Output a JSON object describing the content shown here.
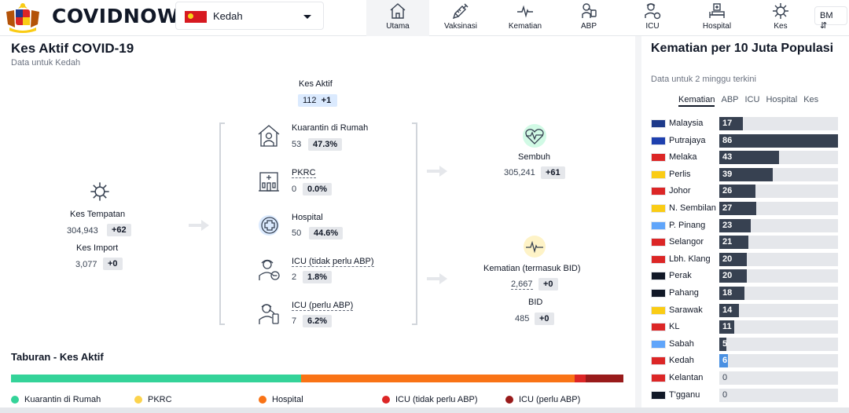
{
  "header": {
    "brand": "COVIDNOW",
    "state_selected": "Kedah",
    "nav": [
      {
        "label": "Utama",
        "icon": "home-icon",
        "active": true
      },
      {
        "label": "Vaksinasi",
        "icon": "syringe-icon"
      },
      {
        "label": "Kematian",
        "icon": "pulse-icon"
      },
      {
        "label": "ABP",
        "icon": "ventilator-icon"
      },
      {
        "label": "ICU",
        "icon": "icu-icon"
      },
      {
        "label": "Hospital",
        "icon": "hospital-bed-icon"
      },
      {
        "label": "Kes",
        "icon": "virus-icon"
      }
    ],
    "lang": "BM"
  },
  "left": {
    "title": "Kes Aktif COVID-19",
    "subtitle": "Data untuk Kedah",
    "active": {
      "label": "Kes Aktif",
      "value": "112",
      "delta": "+1"
    },
    "local": {
      "label": "Kes Tempatan",
      "value": "304,943",
      "delta": "+62"
    },
    "import": {
      "label": "Kes Import",
      "value": "3,077",
      "delta": "+0"
    },
    "items": [
      {
        "label": "Kuarantin di Rumah",
        "value": "53",
        "pct": "47.3%"
      },
      {
        "label": "PKRC",
        "value": "0",
        "pct": "0.0%"
      },
      {
        "label": "Hospital",
        "value": "50",
        "pct": "44.6%"
      },
      {
        "label": "ICU (tidak perlu ABP)",
        "value": "2",
        "pct": "1.8%"
      },
      {
        "label": "ICU (perlu ABP)",
        "value": "7",
        "pct": "6.2%"
      }
    ],
    "recovered": {
      "label": "Sembuh",
      "value": "305,241",
      "delta": "+61"
    },
    "deaths": {
      "label": "Kematian (termasuk BID)",
      "value": "2,667",
      "delta": "+0"
    },
    "bid": {
      "label": "BID",
      "value": "485",
      "delta": "+0"
    },
    "dist_title": "Taburan - Kes Aktif",
    "dist": [
      {
        "label": "Kuarantin di Rumah",
        "pct": 47.3,
        "color": "#34d399"
      },
      {
        "label": "PKRC",
        "pct": 0.0,
        "color": "#fcd34d"
      },
      {
        "label": "Hospital",
        "pct": 44.6,
        "color": "#f97316"
      },
      {
        "label": "ICU (tidak perlu ABP)",
        "pct": 1.8,
        "color": "#dc2626"
      },
      {
        "label": "ICU (perlu ABP)",
        "pct": 6.2,
        "color": "#991b1b"
      }
    ]
  },
  "right": {
    "title": "Kematian per 10 Juta Populasi",
    "subtitle": "Data untuk 2 minggu terkini",
    "tabs": [
      "Kematian",
      "ABP",
      "ICU",
      "Hospital",
      "Kes"
    ],
    "max": 86,
    "rows": [
      {
        "name": "Malaysia",
        "value": 17,
        "flag": "#1e3a8a"
      },
      {
        "name": "Putrajaya",
        "value": 86,
        "flag": "#1e40af"
      },
      {
        "name": "Melaka",
        "value": 43,
        "flag": "#dc2626"
      },
      {
        "name": "Perlis",
        "value": 39,
        "flag": "#facc15"
      },
      {
        "name": "Johor",
        "value": 26,
        "flag": "#dc2626"
      },
      {
        "name": "N. Sembilan",
        "value": 27,
        "flag": "#facc15"
      },
      {
        "name": "P. Pinang",
        "value": 23,
        "flag": "#60a5fa"
      },
      {
        "name": "Selangor",
        "value": 21,
        "flag": "#dc2626"
      },
      {
        "name": "Lbh. Klang",
        "value": 20,
        "flag": "#dc2626"
      },
      {
        "name": "Perak",
        "value": 20,
        "flag": "#111827"
      },
      {
        "name": "Pahang",
        "value": 18,
        "flag": "#111827"
      },
      {
        "name": "Sarawak",
        "value": 14,
        "flag": "#facc15"
      },
      {
        "name": "KL",
        "value": 11,
        "flag": "#dc2626"
      },
      {
        "name": "Sabah",
        "value": 5,
        "flag": "#60a5fa"
      },
      {
        "name": "Kedah",
        "value": 6,
        "flag": "#dc2626",
        "highlight": true
      },
      {
        "name": "Kelantan",
        "value": 0,
        "flag": "#dc2626"
      },
      {
        "name": "T'gganu",
        "value": 0,
        "flag": "#111827"
      }
    ]
  }
}
